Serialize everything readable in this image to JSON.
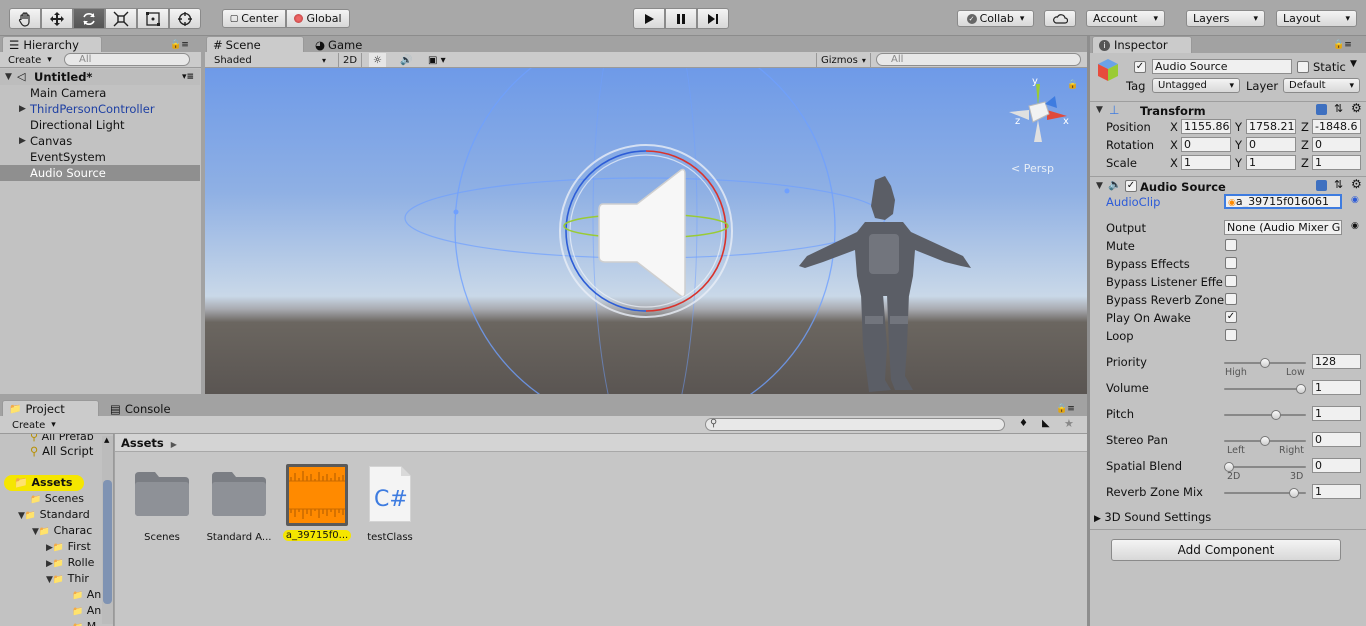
{
  "toolbar": {
    "tools": [
      "hand-tool",
      "move-tool",
      "rotate-tool",
      "scale-tool",
      "rect-tool",
      "transform-tool"
    ],
    "pivot_label": "Center",
    "space_label": "Global",
    "collab_label": "Collab",
    "account_label": "Account",
    "layers_label": "Layers",
    "layout_label": "Layout"
  },
  "hierarchy": {
    "tab": "Hierarchy",
    "create_label": "Create",
    "search_placeholder": "All",
    "scene_name": "Untitled*",
    "items": [
      {
        "label": "Main Camera"
      },
      {
        "label": "ThirdPersonController"
      },
      {
        "label": "Directional Light"
      },
      {
        "label": "Canvas"
      },
      {
        "label": "EventSystem"
      },
      {
        "label": "Audio Source"
      }
    ]
  },
  "scene": {
    "tab_scene": "Scene",
    "tab_game": "Game",
    "shading": "Shaded",
    "mode_2d": "2D",
    "gizmos_label": "Gizmos",
    "search_placeholder": "All",
    "persp_label": "Persp",
    "gizmo_axes": {
      "x": "x",
      "y": "y",
      "z": "z"
    }
  },
  "project": {
    "tab_project": "Project",
    "tab_console": "Console",
    "create_label": "Create",
    "tree": [
      {
        "label": "All Prefab"
      },
      {
        "label": "All Script"
      },
      {
        "label": "Assets"
      },
      {
        "label": "Scenes"
      },
      {
        "label": "Standard"
      },
      {
        "label": "Charac"
      },
      {
        "label": "First"
      },
      {
        "label": "Rolle"
      },
      {
        "label": "Thir"
      },
      {
        "label": "An"
      },
      {
        "label": "An"
      },
      {
        "label": "M"
      }
    ],
    "breadcrumb": "Assets",
    "assets": [
      {
        "label": "Scenes"
      },
      {
        "label": "Standard A..."
      },
      {
        "label": "a_39715f0..."
      },
      {
        "label": "testClass"
      }
    ],
    "script_glyph": "C#"
  },
  "inspector": {
    "tab": "Inspector",
    "object_name": "Audio Source",
    "static_label": "Static",
    "tag_label": "Tag",
    "tag_value": "Untagged",
    "layer_label": "Layer",
    "layer_value": "Default",
    "transform": {
      "title": "Transform",
      "position_label": "Position",
      "rotation_label": "Rotation",
      "scale_label": "Scale",
      "axis_x": "X",
      "axis_y": "Y",
      "axis_z": "Z",
      "position": [
        "1155.86",
        "1758.21",
        "-1848.6"
      ],
      "rotation": [
        "0",
        "0",
        "0"
      ],
      "scale": [
        "1",
        "1",
        "1"
      ]
    },
    "audio": {
      "title": "Audio Source",
      "audioclip_label": "AudioClip",
      "audioclip_value": "a_39715f016061",
      "output_label": "Output",
      "output_value": "None (Audio Mixer G",
      "mute_label": "Mute",
      "bypass_effects_label": "Bypass Effects",
      "bypass_listener_label": "Bypass Listener Effe",
      "bypass_reverb_label": "Bypass Reverb Zone",
      "play_on_awake_label": "Play On Awake",
      "loop_label": "Loop",
      "priority_label": "Priority",
      "priority_value": "128",
      "priority_high": "High",
      "priority_low": "Low",
      "volume_label": "Volume",
      "volume_value": "1",
      "pitch_label": "Pitch",
      "pitch_value": "1",
      "stereo_pan_label": "Stereo Pan",
      "stereo_pan_value": "0",
      "pan_left": "Left",
      "pan_right": "Right",
      "spatial_blend_label": "Spatial Blend",
      "spatial_blend_value": "0",
      "blend_2d": "2D",
      "blend_3d": "3D",
      "reverb_mix_label": "Reverb Zone Mix",
      "reverb_mix_value": "1",
      "sound_settings_label": "3D Sound Settings",
      "mute_checked": false,
      "bypass_effects_checked": false,
      "bypass_listener_checked": false,
      "bypass_reverb_checked": false,
      "play_on_awake_checked": true,
      "loop_checked": false,
      "priority_level": 0.5,
      "volume_level": 1.0,
      "pitch_level": 0.65,
      "stereo_pan_level": 0.5,
      "spatial_blend_level": 0.0,
      "reverb_mix_level": 0.9
    },
    "add_component_label": "Add Component"
  },
  "colors": {
    "accent": "#3e7ce0",
    "selection": "#8f8f8f",
    "asset_highlight": "#f5e600",
    "audio_orange": "#ff8a00"
  }
}
